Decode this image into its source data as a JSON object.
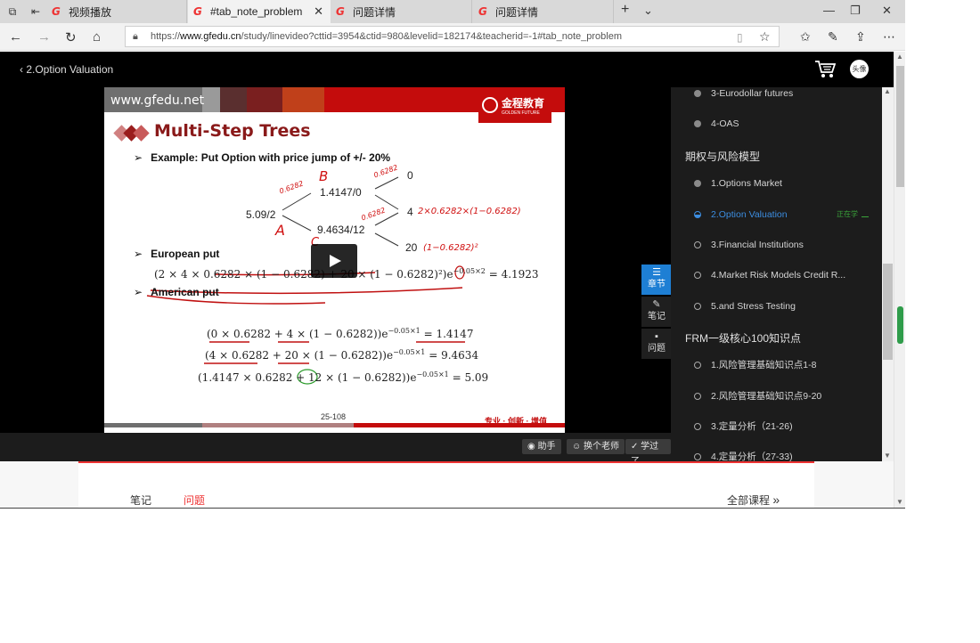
{
  "browser": {
    "tabs": [
      {
        "label": "视频播放"
      },
      {
        "label": "#tab_note_problem"
      },
      {
        "label": "问题详情"
      },
      {
        "label": "问题详情"
      }
    ],
    "url_prefix": "https://",
    "url_domain": "www.gfedu.cn",
    "url_rest": "/study/linevideo?cttid=3954&ctid=980&levelid=182174&teacherid=-1#tab_note_problem"
  },
  "header": {
    "back_label": "2.Option Valuation",
    "avatar_text": "头像"
  },
  "slide": {
    "site": "www.gfedu.net",
    "brand": "金程教育",
    "brand_en": "GOLDEN FUTURE",
    "title": "Multi-Step Trees",
    "example": "Example: Put Option with price jump of +/- 20%",
    "tree": {
      "root": "5.09/2",
      "up": "1.4147/0",
      "down": "9.4634/12",
      "uu": "0",
      "ud": "4",
      "dd": "20"
    },
    "european_put": "European put",
    "american_put": "American put",
    "eq_euro": "(2 × 4 × 0.6282 × (1 − 0.6282) + 20 × (1 − 0.6282)²)e",
    "eq_euro_exp": "−0.05×2",
    "eq_euro_res": "= 4.1923",
    "eq1": "(0 × 0.6282 + 4 × (1 − 0.6282))e",
    "eq1_exp": "−0.05×1",
    "eq1_res": "= 1.4147",
    "eq2": "(4 × 0.6282 + 20 × (1 − 0.6282))e",
    "eq2_exp": "−0.05×1",
    "eq2_res": "= 9.4634",
    "eq3": "(1.4147 × 0.6282 + 12 × (1 − 0.6282))e",
    "eq3_exp": "−0.05×1",
    "eq3_res": "= 5.09",
    "page_number": "25-108",
    "motto": "专业 · 创新 · 增值",
    "handwriting": {
      "b": "B",
      "a": "A",
      "c": "C",
      "prob": "0.6282",
      "ud_note": "2×0.6282×(1−0.6282)",
      "dd_note": "(1−0.6282)²"
    }
  },
  "side_buttons": {
    "chapter": "章节",
    "notes": "笔记",
    "questions": "问题"
  },
  "controls": {
    "assistant": "助手",
    "switch_teacher": "换个老师",
    "learned": "学过了"
  },
  "chapters": {
    "items_top": [
      {
        "label": "3-Eurodollar futures"
      },
      {
        "label": "4-OAS"
      }
    ],
    "group1": "期权与风险模型",
    "group1_items": [
      {
        "label": "1.Options Market"
      },
      {
        "label": "2.Option Valuation"
      },
      {
        "label": "3.Financial Institutions"
      },
      {
        "label": "4.Market Risk Models Credit R..."
      },
      {
        "label": "5.and Stress Testing"
      }
    ],
    "now_learning": "正在学",
    "group2": "FRM一级核心100知识点",
    "group2_items": [
      {
        "label": "1.风险管理基础知识点1-8"
      },
      {
        "label": "2.风险管理基础知识点9-20"
      },
      {
        "label": "3.定量分析（21-26)"
      },
      {
        "label": "4.定量分析（27-33)"
      }
    ]
  },
  "bottom_tabs": {
    "notes": "笔记",
    "questions": "问题",
    "all_courses": "全部课程"
  }
}
